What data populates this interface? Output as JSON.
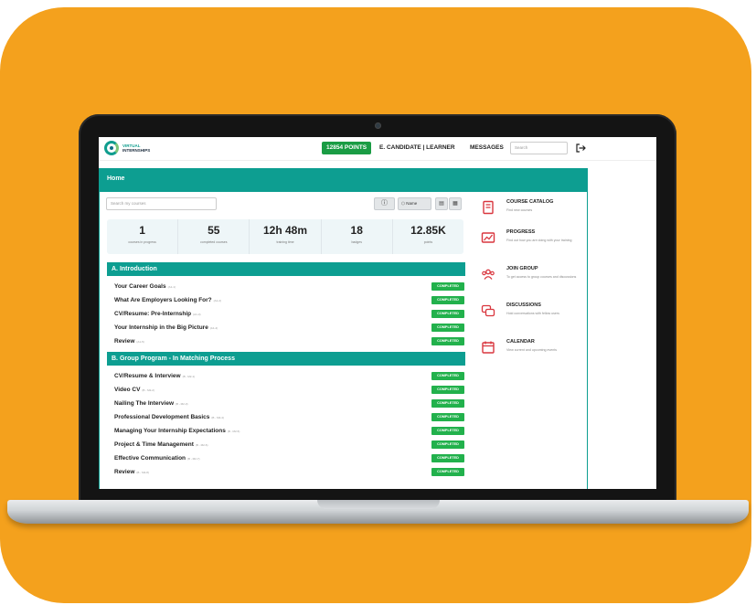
{
  "header": {
    "logo_line1": "VIRTUAL",
    "logo_line2": "INTERNSHIPS",
    "points_badge": "12854 POINTS",
    "user_label": "E. CANDIDATE | LEARNER",
    "messages_label": "MESSAGES",
    "search_placeholder": "Search"
  },
  "home": {
    "title": "Home",
    "search_placeholder": "Search my courses",
    "sort_label": "Name"
  },
  "stats": [
    {
      "value": "1",
      "label": "courses in progress"
    },
    {
      "value": "55",
      "label": "completed courses"
    },
    {
      "value": "12h 48m",
      "label": "training time"
    },
    {
      "value": "18",
      "label": "badges"
    },
    {
      "value": "12.85K",
      "label": "points"
    }
  ],
  "sections": [
    {
      "title": "A. Introduction",
      "courses": [
        {
          "title": "Your Career Goals",
          "meta": "(A1-1)",
          "status": "COMPLETED"
        },
        {
          "title": "What Are Employers Looking For?",
          "meta": "(A1-2)",
          "status": "COMPLETED"
        },
        {
          "title": "CV/Resume: Pre-Internship",
          "meta": "(A1-3)",
          "status": "COMPLETED"
        },
        {
          "title": "Your Internship in the Big Picture",
          "meta": "(A1-4)",
          "status": "COMPLETED"
        },
        {
          "title": "Review",
          "meta": "(A1-5)",
          "status": "COMPLETED"
        }
      ]
    },
    {
      "title": "B. Group Program - In Matching Process",
      "courses": [
        {
          "title": "CV/Resume & Interview",
          "meta": "(B - M2-1)",
          "status": "COMPLETED"
        },
        {
          "title": "Video CV",
          "meta": "(B - M2-2)",
          "status": "COMPLETED"
        },
        {
          "title": "Nailing The Interview",
          "meta": "(B - M2-3)",
          "status": "COMPLETED"
        },
        {
          "title": "Professional Development Basics",
          "meta": "(B - M2-4)",
          "status": "COMPLETED"
        },
        {
          "title": "Managing Your Internship Expectations",
          "meta": "(B - M2-5)",
          "status": "COMPLETED"
        },
        {
          "title": "Project & Time Management",
          "meta": "(B - M2-6)",
          "status": "COMPLETED"
        },
        {
          "title": "Effective Communication",
          "meta": "(B - M2-7)",
          "status": "COMPLETED"
        },
        {
          "title": "Review",
          "meta": "(B - M2-8)",
          "status": "COMPLETED"
        }
      ]
    }
  ],
  "menu": [
    {
      "title": "COURSE CATALOG",
      "desc": "Find new courses",
      "icon": "catalog-icon"
    },
    {
      "title": "PROGRESS",
      "desc": "Find out how you are doing with your training",
      "icon": "progress-icon"
    },
    {
      "title": "JOIN GROUP",
      "desc": "To get access to group courses and discussions",
      "icon": "group-icon"
    },
    {
      "title": "DISCUSSIONS",
      "desc": "Hold conversations with fellow users",
      "icon": "discussion-icon"
    },
    {
      "title": "CALENDAR",
      "desc": "View current and upcoming events",
      "icon": "calendar-icon"
    }
  ],
  "colors": {
    "background_card": "#F4A11D",
    "teal": "#0d9e91",
    "points_green": "#1a9c44",
    "completed_green": "#22b14c",
    "menu_icon_red": "#d9363e"
  }
}
